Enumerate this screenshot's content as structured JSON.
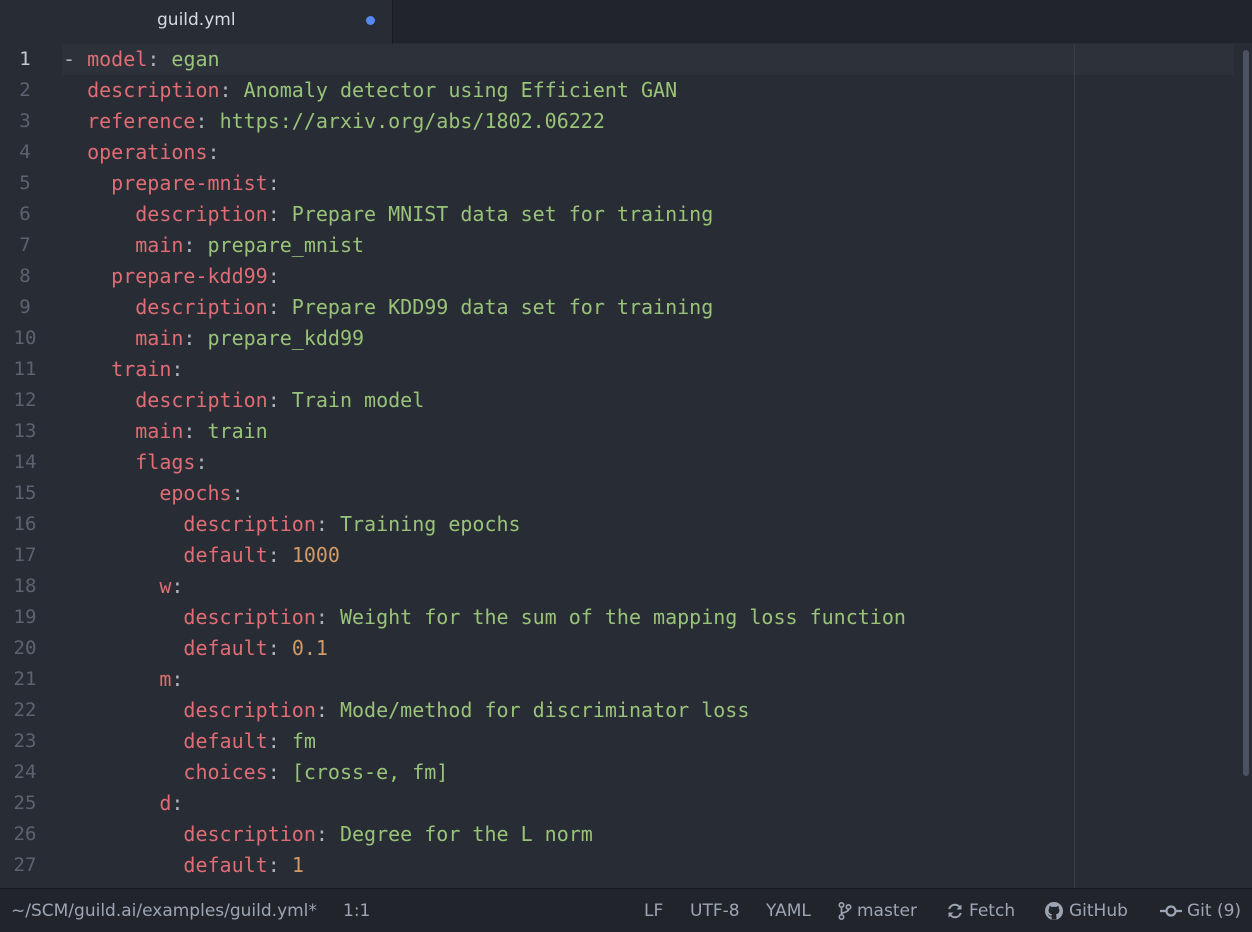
{
  "tab": {
    "title": "guild.yml"
  },
  "lines": [
    {
      "no": "1",
      "indent": "",
      "dash": "- ",
      "key": "model",
      "sep": ": ",
      "val": "egan",
      "vt": "s"
    },
    {
      "no": "2",
      "indent": "  ",
      "dash": "",
      "key": "description",
      "sep": ": ",
      "val": "Anomaly detector using Efficient GAN",
      "vt": "s"
    },
    {
      "no": "3",
      "indent": "  ",
      "dash": "",
      "key": "reference",
      "sep": ": ",
      "val": "https://arxiv.org/abs/1802.06222",
      "vt": "s"
    },
    {
      "no": "4",
      "indent": "  ",
      "dash": "",
      "key": "operations",
      "sep": ":",
      "val": "",
      "vt": "s"
    },
    {
      "no": "5",
      "indent": "    ",
      "dash": "",
      "key": "prepare-mnist",
      "sep": ":",
      "val": "",
      "vt": "s"
    },
    {
      "no": "6",
      "indent": "      ",
      "dash": "",
      "key": "description",
      "sep": ": ",
      "val": "Prepare MNIST data set for training",
      "vt": "s"
    },
    {
      "no": "7",
      "indent": "      ",
      "dash": "",
      "key": "main",
      "sep": ": ",
      "val": "prepare_mnist",
      "vt": "s"
    },
    {
      "no": "8",
      "indent": "    ",
      "dash": "",
      "key": "prepare-kdd99",
      "sep": ":",
      "val": "",
      "vt": "s"
    },
    {
      "no": "9",
      "indent": "      ",
      "dash": "",
      "key": "description",
      "sep": ": ",
      "val": "Prepare KDD99 data set for training",
      "vt": "s"
    },
    {
      "no": "10",
      "indent": "      ",
      "dash": "",
      "key": "main",
      "sep": ": ",
      "val": "prepare_kdd99",
      "vt": "s"
    },
    {
      "no": "11",
      "indent": "    ",
      "dash": "",
      "key": "train",
      "sep": ":",
      "val": "",
      "vt": "s"
    },
    {
      "no": "12",
      "indent": "      ",
      "dash": "",
      "key": "description",
      "sep": ": ",
      "val": "Train model",
      "vt": "s"
    },
    {
      "no": "13",
      "indent": "      ",
      "dash": "",
      "key": "main",
      "sep": ": ",
      "val": "train",
      "vt": "s"
    },
    {
      "no": "14",
      "indent": "      ",
      "dash": "",
      "key": "flags",
      "sep": ":",
      "val": "",
      "vt": "s"
    },
    {
      "no": "15",
      "indent": "        ",
      "dash": "",
      "key": "epochs",
      "sep": ":",
      "val": "",
      "vt": "s"
    },
    {
      "no": "16",
      "indent": "          ",
      "dash": "",
      "key": "description",
      "sep": ": ",
      "val": "Training epochs",
      "vt": "s"
    },
    {
      "no": "17",
      "indent": "          ",
      "dash": "",
      "key": "default",
      "sep": ": ",
      "val": "1000",
      "vt": "n"
    },
    {
      "no": "18",
      "indent": "        ",
      "dash": "",
      "key": "w",
      "sep": ":",
      "val": "",
      "vt": "s"
    },
    {
      "no": "19",
      "indent": "          ",
      "dash": "",
      "key": "description",
      "sep": ": ",
      "val": "Weight for the sum of the mapping loss function",
      "vt": "s"
    },
    {
      "no": "20",
      "indent": "          ",
      "dash": "",
      "key": "default",
      "sep": ": ",
      "val": "0.1",
      "vt": "n"
    },
    {
      "no": "21",
      "indent": "        ",
      "dash": "",
      "key": "m",
      "sep": ":",
      "val": "",
      "vt": "s"
    },
    {
      "no": "22",
      "indent": "          ",
      "dash": "",
      "key": "description",
      "sep": ": ",
      "val": "Mode/method for discriminator loss",
      "vt": "s"
    },
    {
      "no": "23",
      "indent": "          ",
      "dash": "",
      "key": "default",
      "sep": ": ",
      "val": "fm",
      "vt": "s"
    },
    {
      "no": "24",
      "indent": "          ",
      "dash": "",
      "key": "choices",
      "sep": ": ",
      "val": "[cross-e, fm]",
      "vt": "s"
    },
    {
      "no": "25",
      "indent": "        ",
      "dash": "",
      "key": "d",
      "sep": ":",
      "val": "",
      "vt": "s"
    },
    {
      "no": "26",
      "indent": "          ",
      "dash": "",
      "key": "description",
      "sep": ": ",
      "val": "Degree for the L norm",
      "vt": "s"
    },
    {
      "no": "27",
      "indent": "          ",
      "dash": "",
      "key": "default",
      "sep": ": ",
      "val": "1",
      "vt": "n"
    }
  ],
  "status": {
    "path": "~/SCM/guild.ai/examples/guild.yml*",
    "cursor": "1:1",
    "line_ending": "LF",
    "encoding": "UTF-8",
    "grammar": "YAML",
    "branch": "master",
    "fetch": "Fetch",
    "github": "GitHub",
    "git": "Git (9)"
  },
  "colors": {
    "key": "#e06c75",
    "string": "#98c379",
    "number": "#d19a66",
    "modified_dot": "#568af2"
  }
}
